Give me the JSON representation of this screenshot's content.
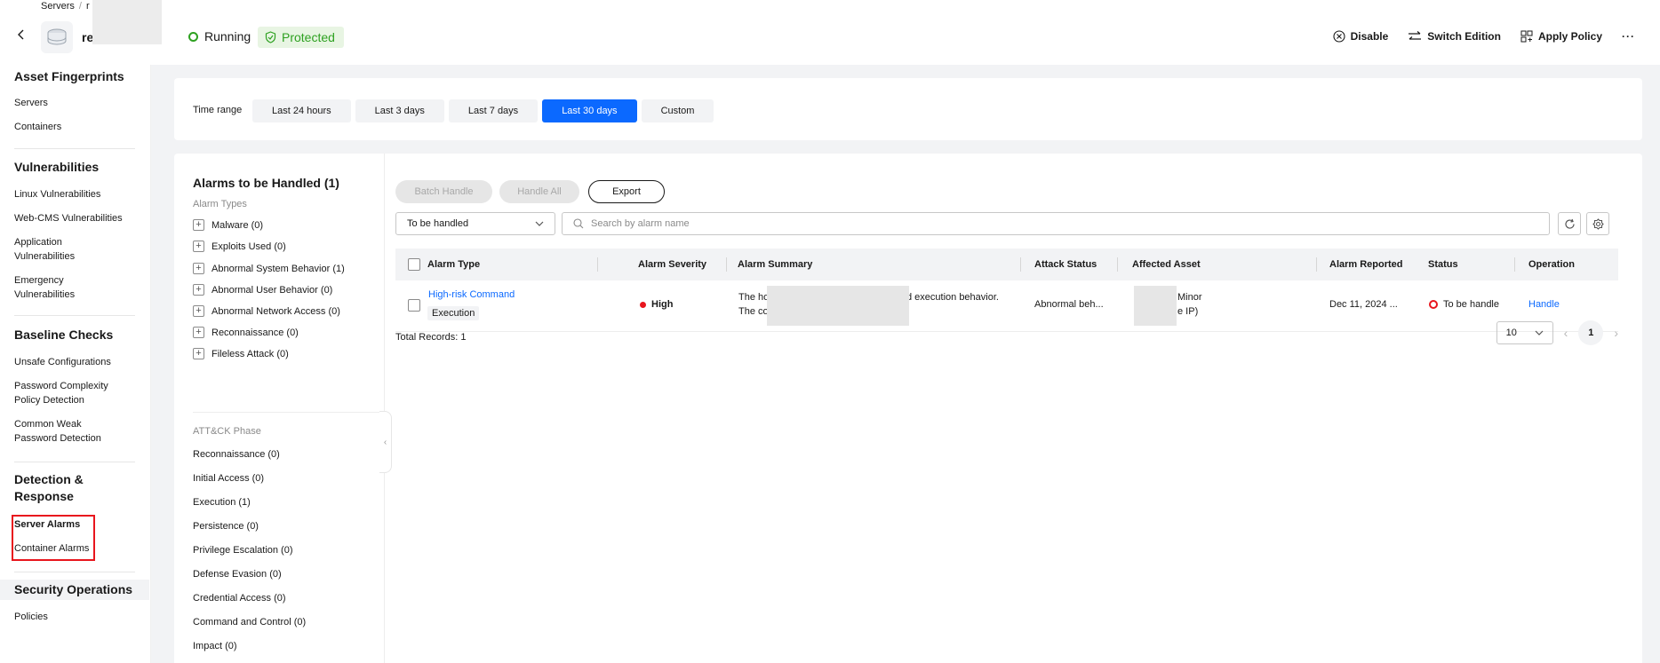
{
  "header": {
    "breadcrumb": [
      "Servers",
      "r"
    ],
    "server_name": "re",
    "status_running": "Running",
    "status_protected": "Protected",
    "actions": {
      "disable": "Disable",
      "switch_edition": "Switch Edition",
      "apply_policy": "Apply Policy",
      "more": "···"
    }
  },
  "sidebar": {
    "groups": [
      {
        "title": "Asset Fingerprints",
        "items": [
          "Servers",
          "Containers"
        ]
      },
      {
        "title": "Vulnerabilities",
        "items": [
          "Linux Vulnerabilities",
          "Web-CMS Vulnerabilities",
          "Application Vulnerabilities",
          "Emergency Vulnerabilities"
        ]
      },
      {
        "title": "Baseline Checks",
        "items": [
          "Unsafe Configurations",
          "Password Complexity Policy Detection",
          "Common Weak Password Detection"
        ]
      },
      {
        "title": "Detection & Response",
        "items": [
          "Server Alarms",
          "Container Alarms"
        ]
      },
      {
        "title": "Security Operations",
        "items": [
          "Policies"
        ]
      }
    ]
  },
  "time_range": {
    "label": "Time range",
    "options": [
      "Last 24 hours",
      "Last 3 days",
      "Last 7 days",
      "Last 30 days",
      "Custom"
    ],
    "selected": "Last 30 days"
  },
  "alarms_panel": {
    "title": "Alarms to be Handled",
    "count": "(1)",
    "types_label": "Alarm Types",
    "types": [
      {
        "name": "Malware",
        "count": "(0)"
      },
      {
        "name": "Exploits Used",
        "count": "(0)"
      },
      {
        "name": "Abnormal System Behavior",
        "count": "(1)"
      },
      {
        "name": "Abnormal User Behavior",
        "count": "(0)"
      },
      {
        "name": "Abnormal Network Access",
        "count": "(0)"
      },
      {
        "name": "Reconnaissance",
        "count": "(0)"
      },
      {
        "name": "Fileless Attack",
        "count": "(0)"
      }
    ],
    "phase_label": "ATT&CK Phase",
    "phases": [
      "Reconnaissance (0)",
      "Initial Access (0)",
      "Execution (1)",
      "Persistence (0)",
      "Privilege Escalation (0)",
      "Defense Evasion (0)",
      "Credential Access (0)",
      "Command and Control (0)",
      "Impact (0)"
    ]
  },
  "toolbar": {
    "batch_handle": "Batch Handle",
    "handle_all": "Handle All",
    "export": "Export",
    "filter_value": "To be handled",
    "search_placeholder": "Search by alarm name"
  },
  "table": {
    "columns": [
      "Alarm Type",
      "Alarm Severity",
      "Alarm Summary",
      "Attack Status",
      "Affected Asset",
      "Alarm Reported",
      "Status",
      "Operation"
    ],
    "rows": [
      {
        "alarm_type": "High-risk Command",
        "alarm_tag": "Execution",
        "severity": "High",
        "summary_line1_start": "The ho",
        "summary_line1_end": "d execution behavior.",
        "summary_line2_start": "The co",
        "attack_status": "Abnormal beh...",
        "asset_line1": "Minor",
        "asset_line2": "e IP)",
        "reported": "Dec 11, 2024 ...",
        "status": "To be handle",
        "operation": "Handle"
      }
    ]
  },
  "footer": {
    "total_records": "Total Records: 1",
    "page_size": "10",
    "current_page": "1"
  }
}
